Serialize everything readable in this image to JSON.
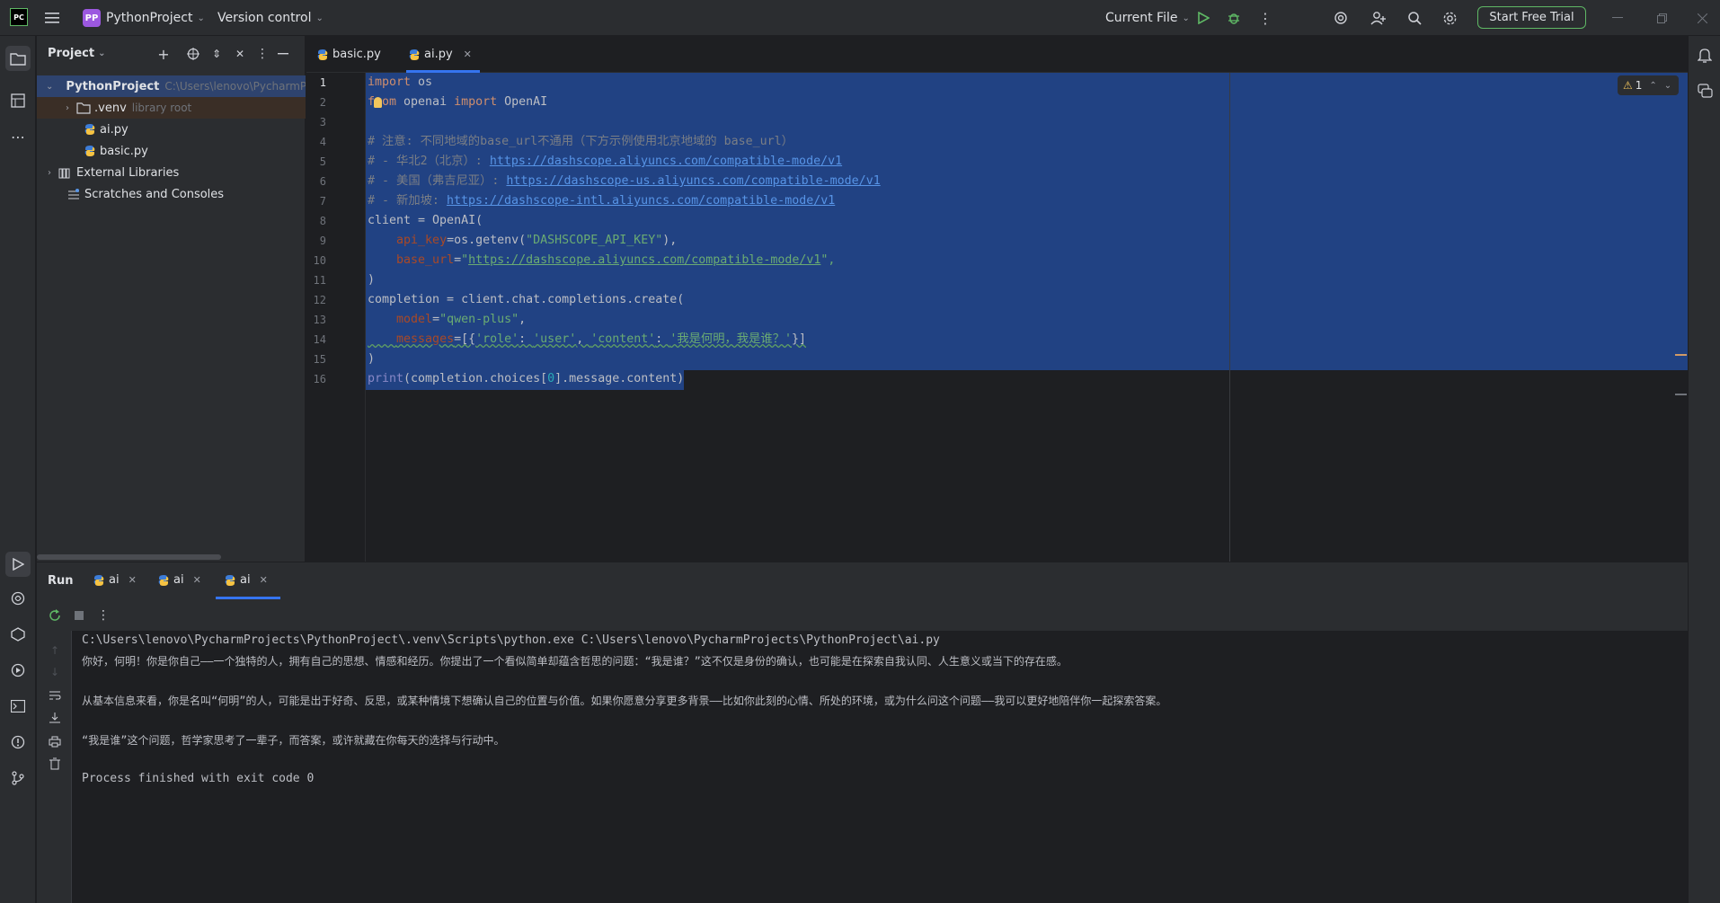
{
  "titlebar": {
    "app_icon": "PC",
    "project_badge": "PP",
    "project_name": "PythonProject",
    "vcs": "Version control",
    "run_config": "Current File",
    "trial_button": "Start Free Trial"
  },
  "project_panel": {
    "title": "Project",
    "items": [
      {
        "label": "PythonProject",
        "hint": "C:\\Users\\lenovo\\PycharmP"
      },
      {
        "label": ".venv",
        "hint": "library root"
      },
      {
        "label": "ai.py"
      },
      {
        "label": "basic.py"
      },
      {
        "label": "External Libraries"
      },
      {
        "label": "Scratches and Consoles"
      }
    ]
  },
  "editor": {
    "tabs": [
      {
        "label": "basic.py"
      },
      {
        "label": "ai.py",
        "active": true
      }
    ],
    "problems_count": "1",
    "line_numbers": [
      "1",
      "2",
      "3",
      "4",
      "5",
      "6",
      "7",
      "8",
      "9",
      "10",
      "11",
      "12",
      "13",
      "14",
      "15",
      "16"
    ]
  },
  "code": {
    "l1_kw": "import",
    "l1_rest": " os",
    "l2_kw1": "from",
    "l2_mid": " openai ",
    "l2_kw2": "import",
    "l2_rest": " OpenAI",
    "l4": "# 注意: 不同地域的base_url不通用（下方示例使用北京地域的 base_url）",
    "l5_pre": "# - 华北2（北京）: ",
    "l5_url": "https://dashscope.aliyuncs.com/compatible-mode/v1",
    "l6_pre": "# - 美国（弗吉尼亚）: ",
    "l6_url": "https://dashscope-us.aliyuncs.com/compatible-mode/v1",
    "l7_pre": "# - 新加坡: ",
    "l7_url": "https://dashscope-intl.aliyuncs.com/compatible-mode/v1",
    "l8": "client = OpenAI(",
    "l9_par": "api_key",
    "l9_mid": "=os.getenv(",
    "l9_str": "\"DASHSCOPE_API_KEY\"",
    "l9_end": "),",
    "l10_par": "base_url",
    "l10_eq": "=",
    "l10_q1": "\"",
    "l10_url": "https://dashscope.aliyuncs.com/compatible-mode/v1",
    "l10_q2": "\",",
    "l11": ")",
    "l12": "completion = client.chat.completions.create(",
    "l13_par": "model",
    "l13_eq": "=",
    "l13_str": "\"qwen-plus\"",
    "l13_end": ",",
    "l14_par": "messages",
    "l14_eq": "=[{",
    "l14_s1": "'role'",
    "l14_c1": ": ",
    "l14_s2": "'user'",
    "l14_c2": ", ",
    "l14_s3": "'content'",
    "l14_c3": ": ",
    "l14_s4": "'我是何明，我是谁？'",
    "l14_end": "}]",
    "l15": ")",
    "l16_fn": "print",
    "l16_a": "(completion.choices[",
    "l16_num": "0",
    "l16_b": "].message.content)"
  },
  "run_panel": {
    "title": "Run",
    "tabs": [
      "ai",
      "ai",
      "ai"
    ],
    "output": [
      "C:\\Users\\lenovo\\PycharmProjects\\PythonProject\\.venv\\Scripts\\python.exe C:\\Users\\lenovo\\PycharmProjects\\PythonProject\\ai.py",
      "你好，何明！你是你自己——一个独特的人，拥有自己的思想、情感和经历。你提出了一个看似简单却蕴含哲思的问题：“我是谁？”这不仅是身份的确认，也可能是在探索自我认同、人生意义或当下的存在感。",
      "从基本信息来看，你是名叫“何明”的人，可能是出于好奇、反思，或某种情境下想确认自己的位置与价值。如果你愿意分享更多背景——比如你此刻的心情、所处的环境，或为什么问这个问题——我可以更好地陪伴你一起探索答案。",
      "“我是谁”这个问题，哲学家思考了一辈子，而答案，或许就藏在你每天的选择与行动中。",
      "Process finished with exit code 0"
    ]
  },
  "colors": {
    "selection": "#214283",
    "accent_green": "#5fb865",
    "badge_purple": "#9c58e0"
  }
}
